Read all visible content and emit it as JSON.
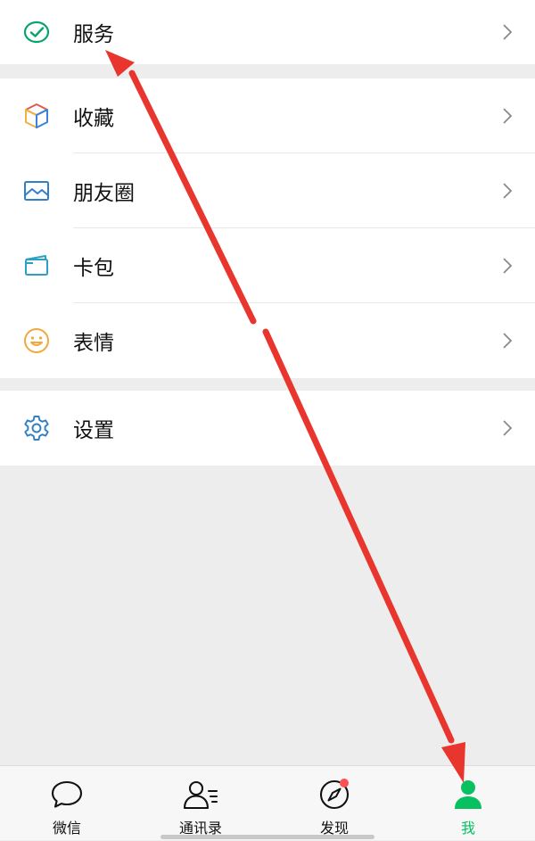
{
  "menu": {
    "service": {
      "label": "服务",
      "icon": "service-check-icon"
    },
    "group2": [
      {
        "label": "收藏",
        "icon": "favorites-cube-icon"
      },
      {
        "label": "朋友圈",
        "icon": "moments-picture-icon"
      },
      {
        "label": "卡包",
        "icon": "card-wallet-icon"
      },
      {
        "label": "表情",
        "icon": "smiley-face-icon"
      }
    ],
    "settings": {
      "label": "设置",
      "icon": "gear-icon"
    }
  },
  "tabbar": {
    "tabs": [
      {
        "label": "微信",
        "icon": "chat-bubble-icon"
      },
      {
        "label": "通讯录",
        "icon": "contacts-icon"
      },
      {
        "label": "发现",
        "icon": "compass-icon",
        "badge": true
      },
      {
        "label": "我",
        "icon": "person-icon",
        "active": true
      }
    ]
  },
  "colors": {
    "accent": "#07c160",
    "annotation_arrow": "#e8352e",
    "badge": "#fa5151"
  }
}
